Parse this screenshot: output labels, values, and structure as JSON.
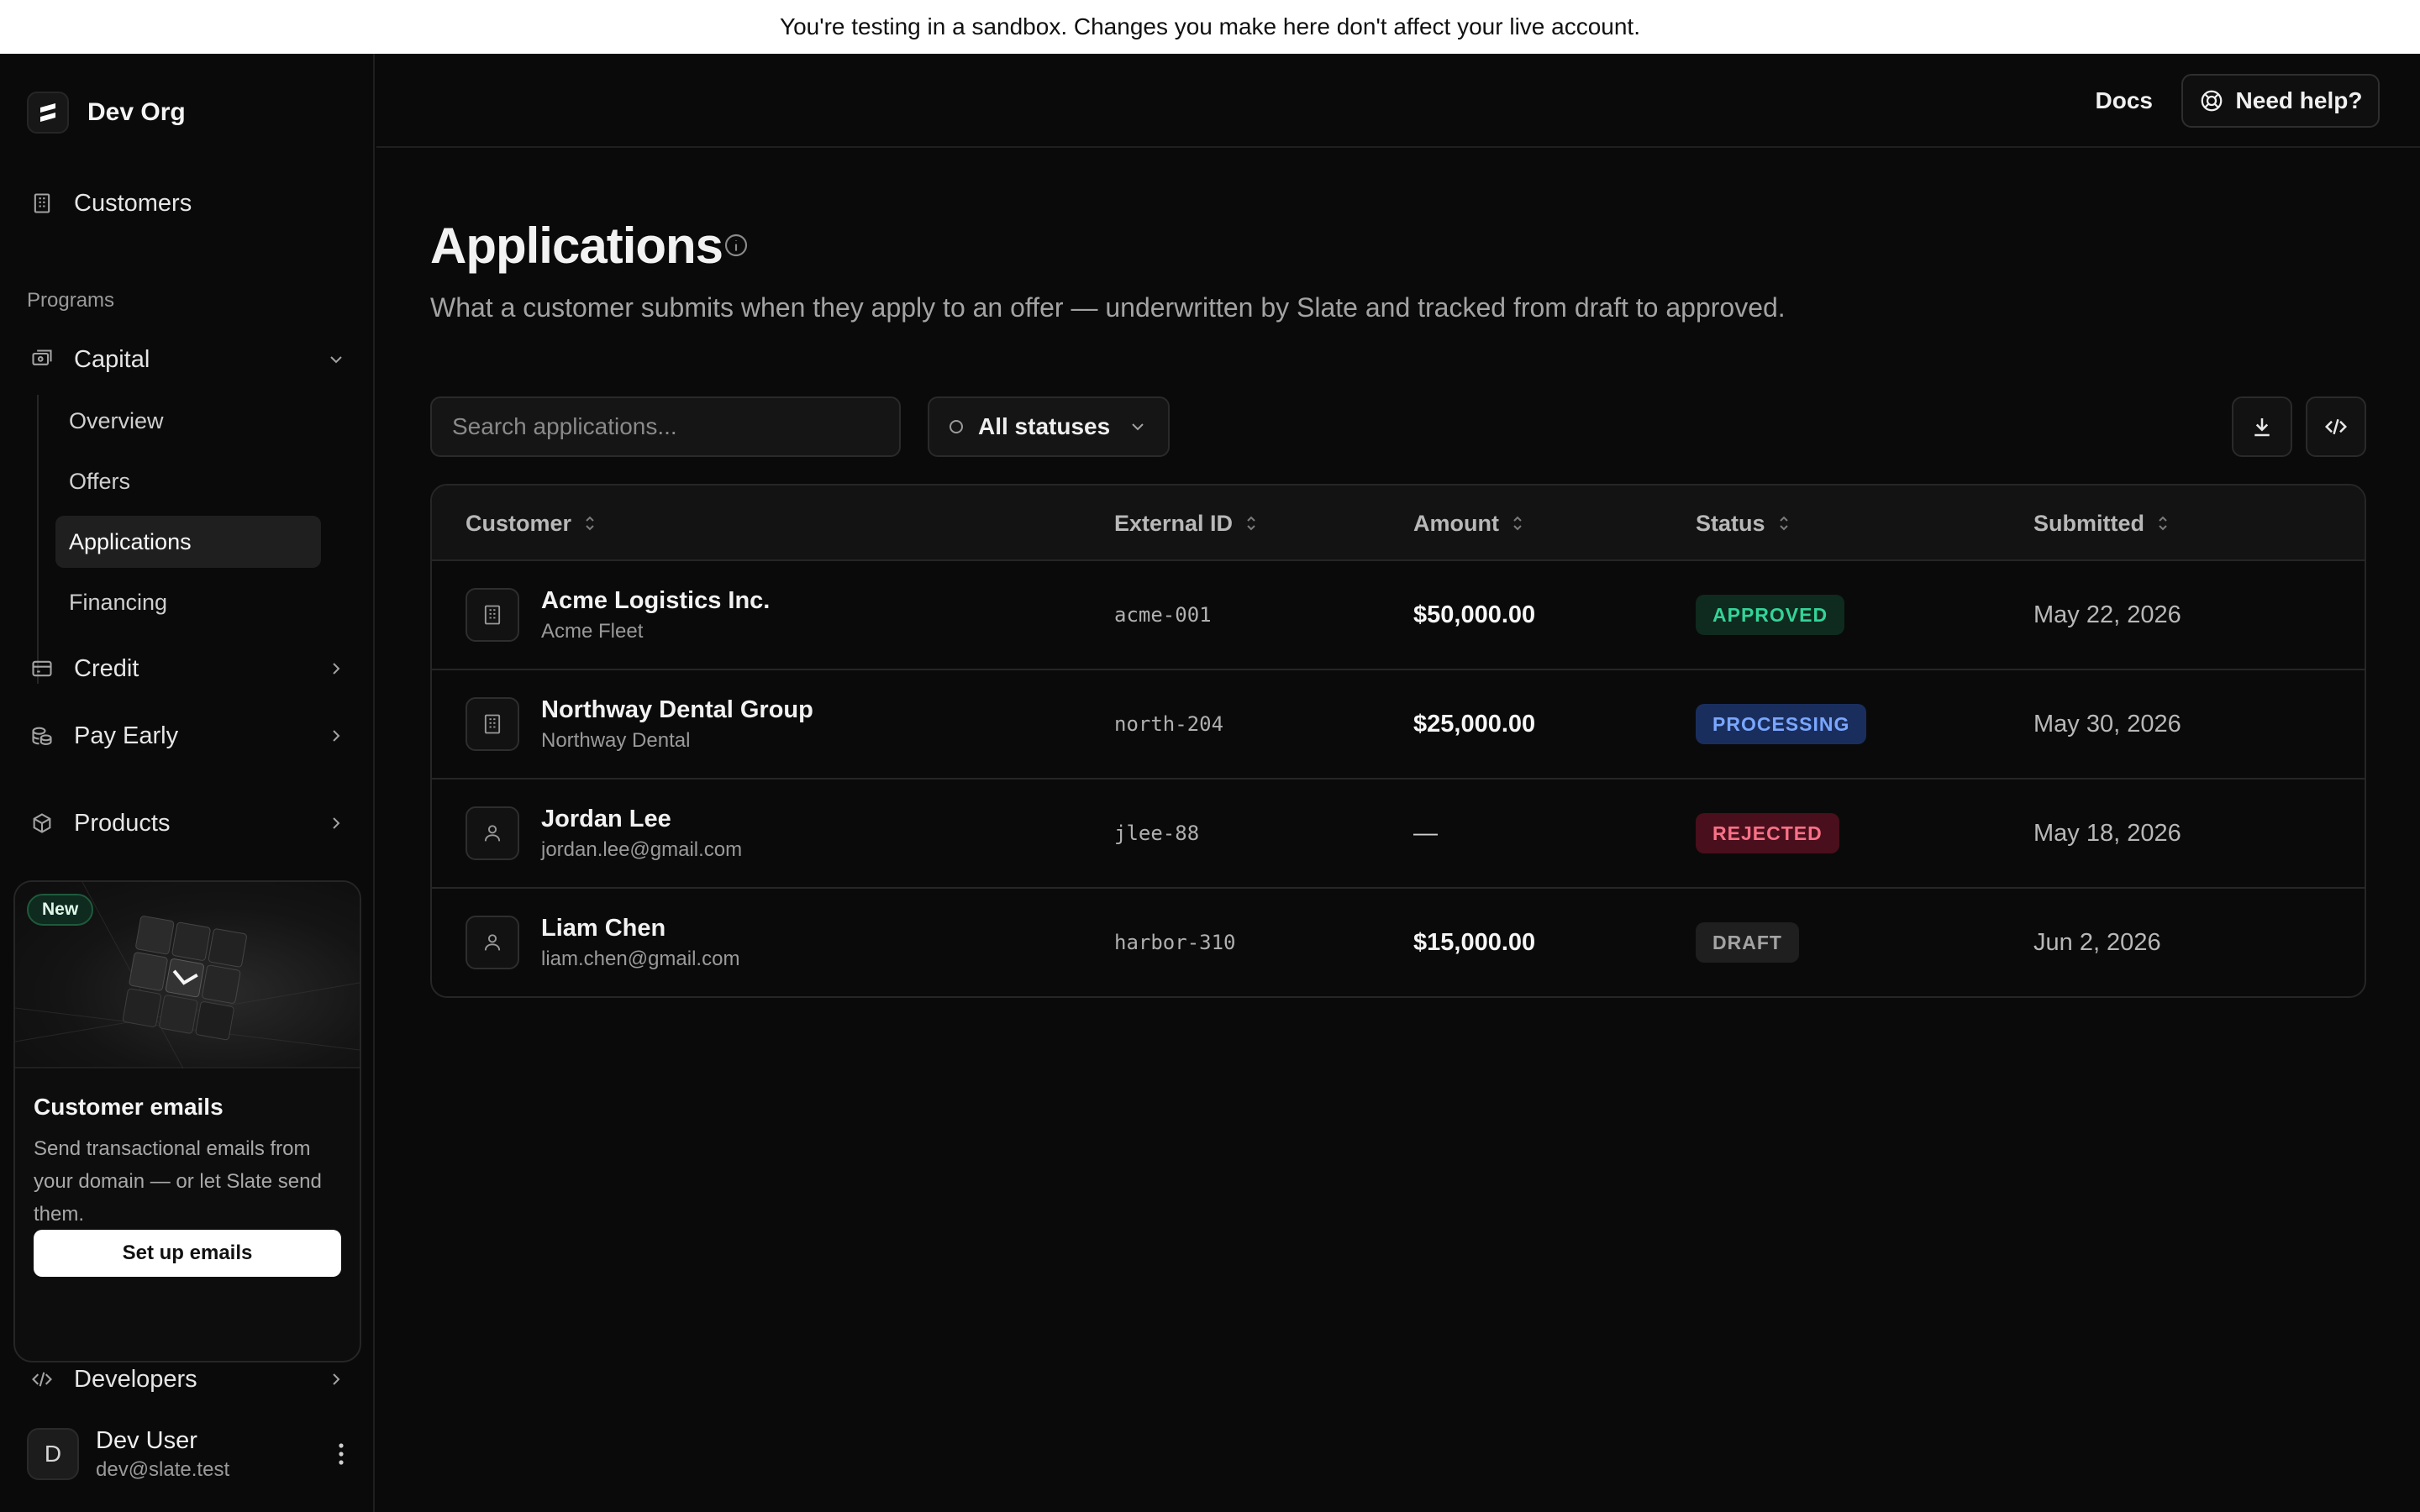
{
  "banner": {
    "text": "You're testing in a sandbox. Changes you make here don't affect your live account."
  },
  "org": {
    "name": "Dev Org"
  },
  "sidebar": {
    "customers_label": "Customers",
    "programs_label": "Programs",
    "capital": {
      "label": "Capital",
      "children": [
        "Overview",
        "Offers",
        "Applications",
        "Financing"
      ],
      "active": "Applications"
    },
    "credit_label": "Credit",
    "pay_early_label": "Pay Early",
    "products_label": "Products",
    "developers_label": "Developers"
  },
  "promo": {
    "badge": "New",
    "title": "Customer emails",
    "text": "Send transactional emails from your domain — or let Slate send them.",
    "button": "Set up emails"
  },
  "user": {
    "initial": "D",
    "name": "Dev User",
    "email": "dev@slate.test"
  },
  "topbar": {
    "docs": "Docs",
    "help": "Need help?"
  },
  "page": {
    "title": "Applications",
    "description": "What a customer submits when they apply to an offer — underwritten by Slate and tracked from draft to approved."
  },
  "toolbar": {
    "search_placeholder": "Search applications...",
    "status_filter": "All statuses"
  },
  "table": {
    "columns": [
      "Customer",
      "External ID",
      "Amount",
      "Status",
      "Submitted"
    ],
    "rows": [
      {
        "type": "business",
        "name": "Acme Logistics Inc.",
        "sub": "Acme Fleet",
        "external_id": "acme-001",
        "amount": "$50,000.00",
        "status": "APPROVED",
        "submitted": "May 22, 2026"
      },
      {
        "type": "business",
        "name": "Northway Dental Group",
        "sub": "Northway Dental",
        "external_id": "north-204",
        "amount": "$25,000.00",
        "status": "PROCESSING",
        "submitted": "May 30, 2026"
      },
      {
        "type": "person",
        "name": "Jordan Lee",
        "sub": "jordan.lee@gmail.com",
        "external_id": "jlee-88",
        "amount": "—",
        "status": "REJECTED",
        "submitted": "May 18, 2026"
      },
      {
        "type": "person",
        "name": "Liam Chen",
        "sub": "liam.chen@gmail.com",
        "external_id": "harbor-310",
        "amount": "$15,000.00",
        "status": "DRAFT",
        "submitted": "Jun 2, 2026"
      }
    ]
  },
  "colors": {
    "approved": "#34d399",
    "processing": "#7aa7ff",
    "rejected": "#f87188",
    "draft": "#a3a3a3"
  },
  "icons": {
    "customers": "building-icon",
    "capital": "banknote-icon",
    "credit": "card-icon",
    "pay_early": "coins-icon",
    "products": "box-icon",
    "developers": "code-icon",
    "help": "lifebuoy-icon",
    "info": "info-icon",
    "download": "download-icon",
    "api": "code-icon"
  }
}
